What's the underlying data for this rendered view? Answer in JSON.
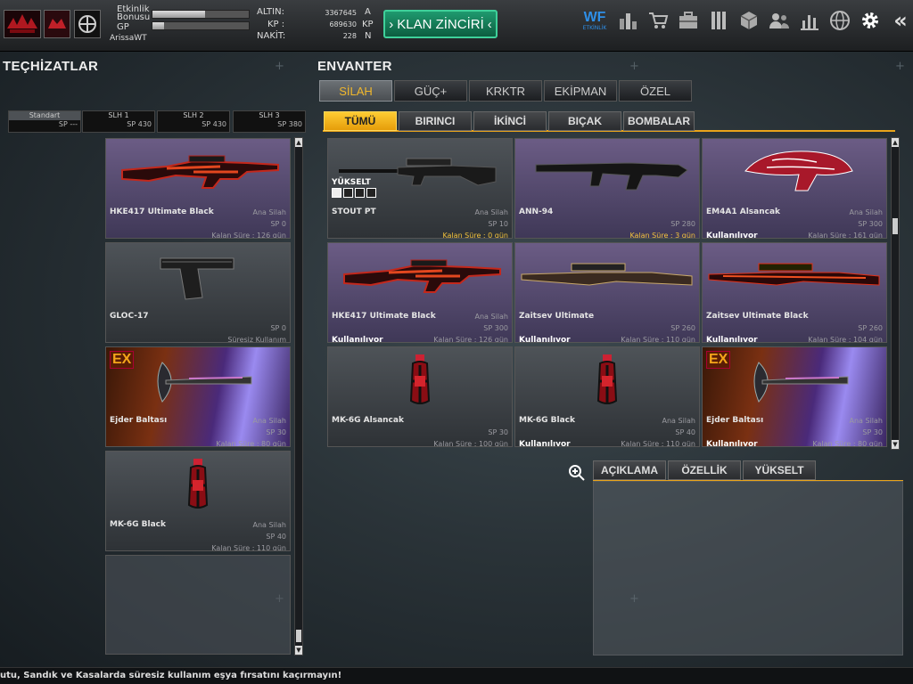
{
  "player": {
    "stats_labels": {
      "etkinlik": "Etkinlik",
      "bonusu": "Bonusu",
      "gp": "GP"
    },
    "bonus_progress": 0.55,
    "gp_progress": 0.12,
    "name": "ArissaWT"
  },
  "currency": {
    "altin_label": "ALTIN:",
    "altin_value": "3367645",
    "altin_unit": "A",
    "kp_label": "KP :",
    "kp_value": "689630",
    "kp_unit": "KP",
    "nakit_label": "NAKİT:",
    "nakit_value": "228",
    "nakit_unit": "N"
  },
  "klan_button": "KLAN ZİNCİRİ",
  "etkinlik_icon_label": "ETKİNLİK",
  "top_icons": [
    "ranking-icon",
    "cart-icon",
    "briefcase-icon",
    "tools-icon",
    "box-icon",
    "users-icon",
    "stats-icon",
    "globe-icon",
    "gear-icon",
    "back-icon"
  ],
  "left_title": "TEÇHİZATLAR",
  "slots": [
    {
      "name": "Standart",
      "sp": "SP ---"
    },
    {
      "name": "SLH 1",
      "sp": "SP 430"
    },
    {
      "name": "SLH 2",
      "sp": "SP 430"
    },
    {
      "name": "SLH 3",
      "sp": "SP 380"
    }
  ],
  "equipped": [
    {
      "name": "HKE417 Ultimate Black",
      "type": "Ana Silah",
      "sp": "SP 0",
      "ks": "Kalan Süre : 126 gün",
      "style": "p",
      "icon": "rifle"
    },
    {
      "name": "GLOC-17",
      "type": "",
      "sp": "SP 0",
      "ks": "Süresiz Kullanım",
      "style": "g",
      "icon": "pistol"
    },
    {
      "name": "Ejder Baltası",
      "type": "Ana Silah",
      "sp": "SP 30",
      "ks": "Kalan Süre : 80 gün",
      "style": "ex",
      "icon": "axe",
      "badge": "EX"
    },
    {
      "name": "MK-6G Black",
      "type": "Ana Silah",
      "sp": "SP 40",
      "ks": "Kalan Süre : 110 gün",
      "style": "g",
      "icon": "grenade"
    }
  ],
  "right_title": "ENVANTER",
  "main_tabs": [
    "SİLAH",
    "GÜÇ+",
    "KRKTR",
    "EKİPMAN",
    "ÖZEL"
  ],
  "sub_tabs": [
    "TÜMÜ",
    "BIRINCI",
    "İKİNCİ",
    "BIÇAK",
    "BOMBALAR"
  ],
  "inventory": [
    {
      "name": "STOUT PT",
      "type": "Ana Silah",
      "sp": "SP 10",
      "ks": "Kalan Süre : 0 gün",
      "ks_warn": true,
      "status": "",
      "style": "g",
      "icon": "sniper",
      "upgrade": "YÜKSELT"
    },
    {
      "name": "ANN-94",
      "type": "",
      "sp": "SP 280",
      "ks": "Kalan Süre : 3 gün",
      "ks_warn": true,
      "status": "",
      "style": "p",
      "icon": "ak"
    },
    {
      "name": "EM4A1 Alsancak",
      "type": "Ana Silah",
      "sp": "SP 300",
      "ks": "Kalan Süre : 161 gün",
      "status": "Kullanılıyor",
      "style": "p",
      "icon": "pattern"
    },
    {
      "name": "HKE417 Ultimate Black",
      "type": "Ana Silah",
      "sp": "SP 300",
      "ks": "Kalan Süre : 126 gün",
      "status": "Kullanılıyor",
      "style": "p",
      "icon": "rifle"
    },
    {
      "name": "Zaitsev Ultimate",
      "type": "",
      "sp": "SP 260",
      "ks": "Kalan Süre : 110 gün",
      "status": "Kullanılıyor",
      "style": "p",
      "icon": "zaitsev"
    },
    {
      "name": "Zaitsev Ultimate Black",
      "type": "",
      "sp": "SP 260",
      "ks": "Kalan Süre : 104 gün",
      "status": "Kullanılıyor",
      "style": "p",
      "icon": "zaitsevb"
    },
    {
      "name": "MK-6G Alsancak",
      "type": "",
      "sp": "SP 30",
      "ks": "Kalan Süre : 100 gün",
      "status": "",
      "style": "g",
      "icon": "grenade"
    },
    {
      "name": "MK-6G Black",
      "type": "Ana Silah",
      "sp": "SP 40",
      "ks": "Kalan Süre : 110 gün",
      "status": "Kullanılıyor",
      "style": "g",
      "icon": "grenade"
    },
    {
      "name": "Ejder Baltası",
      "type": "Ana Silah",
      "sp": "SP 30",
      "ks": "Kalan Süre : 80 gün",
      "status": "Kullanılıyor",
      "style": "ex",
      "icon": "axe",
      "badge": "EX"
    }
  ],
  "detail_tabs": [
    "AÇIKLAMA",
    "ÖZELLİK",
    "YÜKSELT"
  ],
  "ticker": "utu, Sandık ve Kasalarda süresiz kullanım eşya fırsatını kaçırmayın!"
}
